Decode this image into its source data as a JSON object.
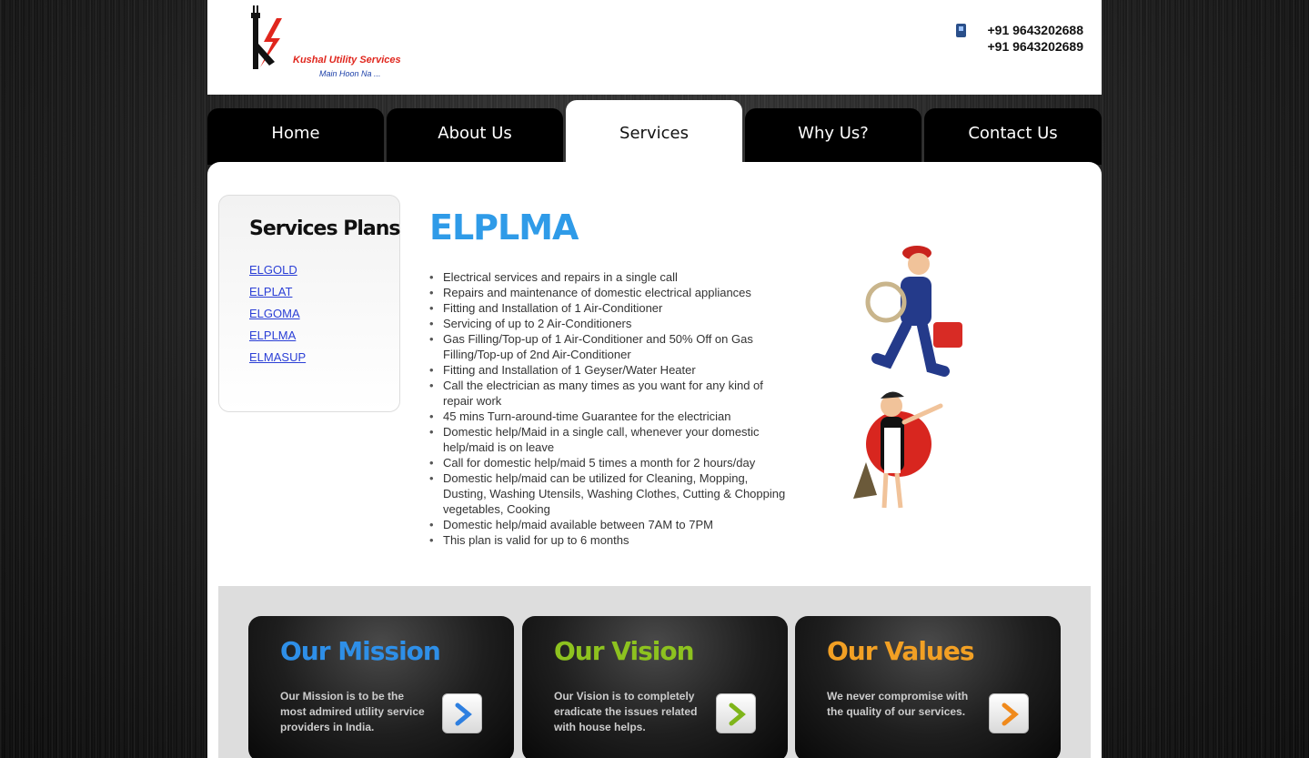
{
  "header": {
    "logo_text": "Kushal Utility Services",
    "logo_tagline": "Main Hoon Na ...",
    "phones": [
      "+91 9643202688",
      "+91 9643202689"
    ]
  },
  "nav": {
    "tabs": [
      {
        "label": "Home"
      },
      {
        "label": "About Us"
      },
      {
        "label": "Services"
      },
      {
        "label": "Why Us?"
      },
      {
        "label": "Contact Us"
      }
    ],
    "active": "Services"
  },
  "sidebar": {
    "title": "Services Plans",
    "links": [
      {
        "label": "ELGOLD"
      },
      {
        "label": "ELPLAT"
      },
      {
        "label": "ELGOMA"
      },
      {
        "label": "ELPLMA"
      },
      {
        "label": "ELMASUP"
      }
    ]
  },
  "plan": {
    "title": "ELPLMA",
    "features": [
      "Electrical services and repairs in a single call",
      "Repairs and maintenance of domestic electrical appliances",
      "Fitting and Installation of 1 Air-Conditioner",
      "Servicing of up to 2 Air-Conditioners",
      "Gas Filling/Top-up of 1 Air-Conditioner and 50% Off on Gas Filling/Top-up of 2nd Air-Conditioner",
      "Fitting and Installation of 1 Geyser/Water Heater",
      "Call the electrician as many times as you want for any kind of repair work",
      "45 mins Turn-around-time Guarantee for the electrician",
      "Domestic help/Maid in a single call, whenever your domestic help/maid is on leave",
      "Call for domestic help/maid 5 times a month for 2 hours/day",
      "Domestic help/maid can be utilized for Cleaning, Mopping, Dusting, Washing Utensils, Washing Clothes, Cutting & Chopping vegetables, Cooking",
      "Domestic help/maid available between 7AM to 7PM",
      "This plan is valid for up to 6 months"
    ]
  },
  "panels": [
    {
      "title": "Our Mission",
      "text": "Our Mission is to be the most admired utility service providers in India.",
      "color": "#2e8fe8",
      "arrow_color": "#2e7fe0"
    },
    {
      "title": "Our Vision",
      "text": "Our Vision is to completely eradicate the issues related with house helps.",
      "color": "#8dc21f",
      "arrow_color": "#7fb51a"
    },
    {
      "title": "Our Values",
      "text": "We never compromise with the quality of our services.",
      "color": "#f2a024",
      "arrow_color": "#f08a1c"
    }
  ],
  "colors": {
    "accent_blue": "#2f9be8",
    "link_blue": "#2b3fd6",
    "logo_red": "#e0261d"
  }
}
